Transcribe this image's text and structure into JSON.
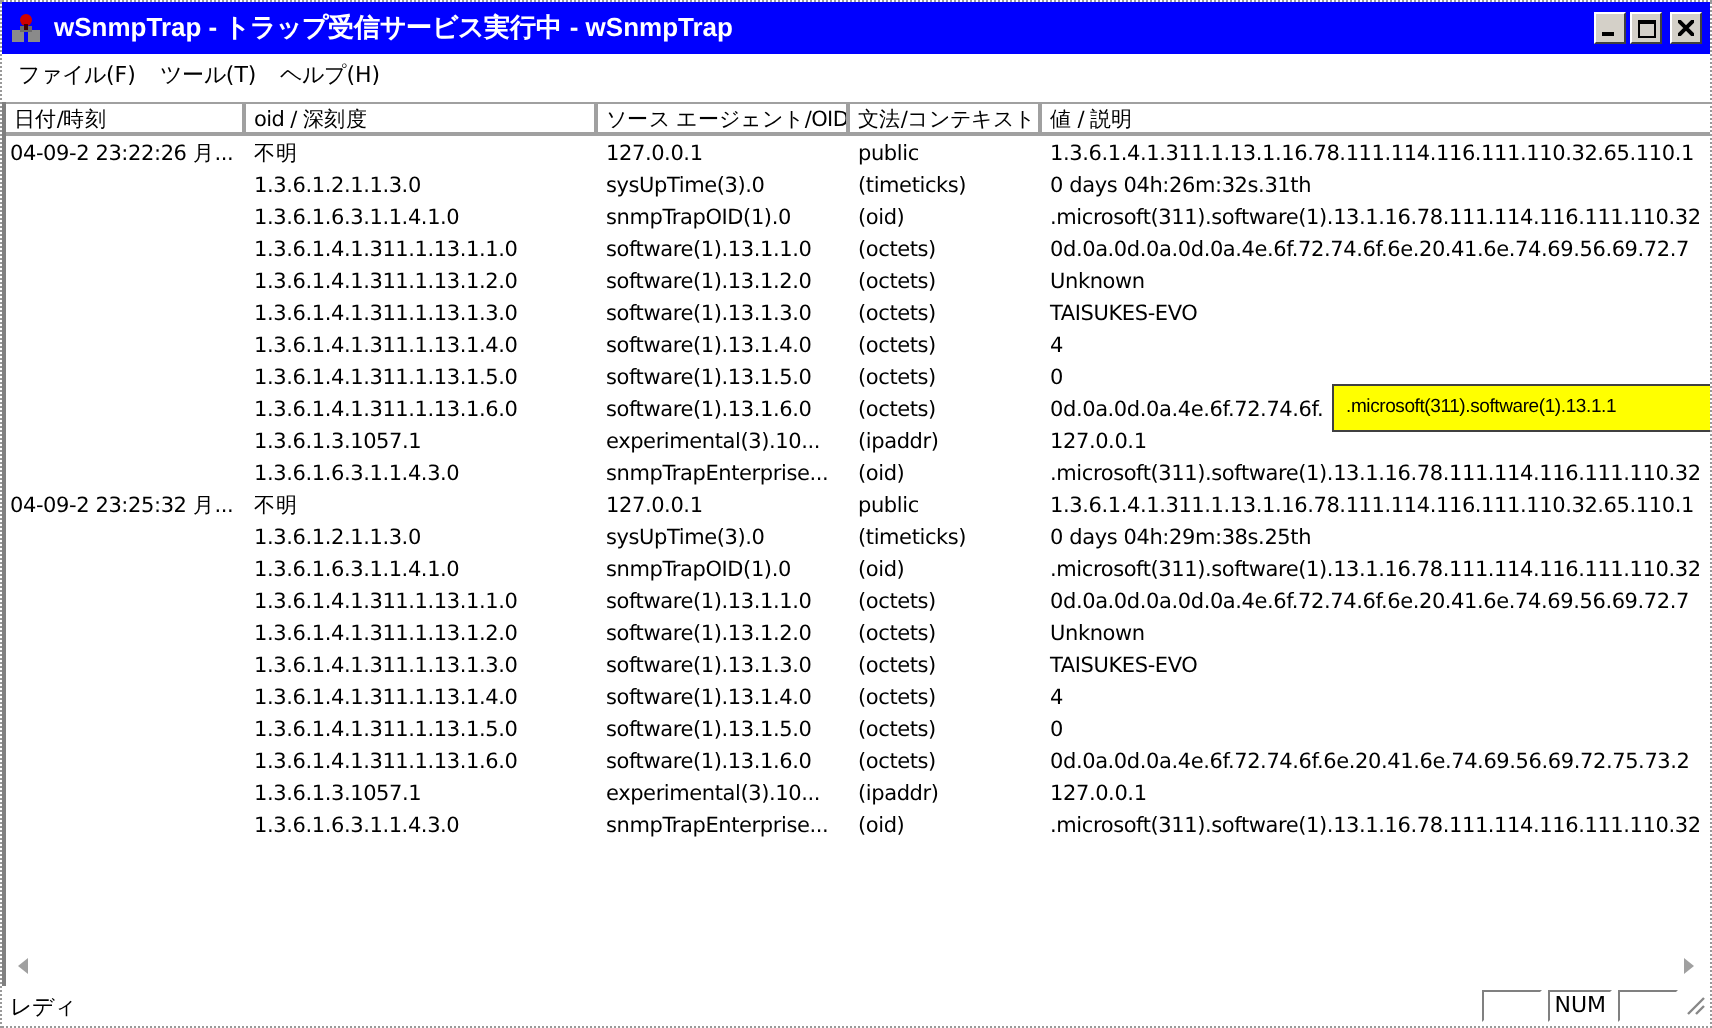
{
  "window": {
    "title": "wSnmpTrap - トラップ受信サービス実行中 - wSnmpTrap"
  },
  "menu": [
    "ファイル(F)",
    "ツール(T)",
    "ヘルプ(H)"
  ],
  "table": {
    "columns": [
      "日付/時刻",
      "oid / 深刻度",
      "ソース エージェント/OID",
      "文法/コンテキスト",
      "値 / 説明"
    ],
    "rows": [
      {
        "date": "04-09-2 23:22:26 月...",
        "oid": "不明",
        "agent": "127.0.0.1",
        "syntax": "public",
        "value": "1.3.6.1.4.1.311.1.13.1.16.78.111.114.116.111.110.32.65.110.1"
      },
      {
        "oid": "1.3.6.1.2.1.1.3.0",
        "agent": "sysUpTime(3).0",
        "syntax": "(timeticks)",
        "value": "0 days 04h:26m:32s.31th"
      },
      {
        "oid": "1.3.6.1.6.3.1.1.4.1.0",
        "agent": "snmpTrapOID(1).0",
        "syntax": "(oid)",
        "value": ".microsoft(311).software(1).13.1.16.78.111.114.116.111.110.32"
      },
      {
        "oid": "1.3.6.1.4.1.311.1.13.1.1.0",
        "agent": "software(1).13.1.1.0",
        "syntax": "(octets)",
        "value": "0d.0a.0d.0a.0d.0a.4e.6f.72.74.6f.6e.20.41.6e.74.69.56.69.72.7"
      },
      {
        "oid": "1.3.6.1.4.1.311.1.13.1.2.0",
        "agent": "software(1).13.1.2.0",
        "syntax": "(octets)",
        "value": "Unknown"
      },
      {
        "oid": "1.3.6.1.4.1.311.1.13.1.3.0",
        "agent": "software(1).13.1.3.0",
        "syntax": "(octets)",
        "value": "TAISUKES-EVO"
      },
      {
        "oid": "1.3.6.1.4.1.311.1.13.1.4.0",
        "agent": "software(1).13.1.4.0",
        "syntax": "(octets)",
        "value": "4"
      },
      {
        "oid": "1.3.6.1.4.1.311.1.13.1.5.0",
        "agent": "software(1).13.1.5.0",
        "syntax": "(octets)",
        "value": "0"
      },
      {
        "oid": "1.3.6.1.4.1.311.1.13.1.6.0",
        "agent": "software(1).13.1.6.0",
        "syntax": "(octets)",
        "value": "0d.0a.0d.0a.4e.6f.72.74.6f.",
        "tooltip": ".microsoft(311).software(1).13.1.1"
      },
      {
        "oid": "1.3.6.1.3.1057.1",
        "agent": "experimental(3).10...",
        "syntax": "(ipaddr)",
        "value": "127.0.0.1"
      },
      {
        "oid": "1.3.6.1.6.3.1.1.4.3.0",
        "agent": "snmpTrapEnterprise...",
        "syntax": "(oid)",
        "value": ".microsoft(311).software(1).13.1.16.78.111.114.116.111.110.32"
      },
      {
        "date": "04-09-2 23:25:32 月...",
        "oid": "不明",
        "agent": "127.0.0.1",
        "syntax": "public",
        "value": "1.3.6.1.4.1.311.1.13.1.16.78.111.114.116.111.110.32.65.110.1"
      },
      {
        "oid": "1.3.6.1.2.1.1.3.0",
        "agent": "sysUpTime(3).0",
        "syntax": "(timeticks)",
        "value": "0 days 04h:29m:38s.25th"
      },
      {
        "oid": "1.3.6.1.6.3.1.1.4.1.0",
        "agent": "snmpTrapOID(1).0",
        "syntax": "(oid)",
        "value": ".microsoft(311).software(1).13.1.16.78.111.114.116.111.110.32"
      },
      {
        "oid": "1.3.6.1.4.1.311.1.13.1.1.0",
        "agent": "software(1).13.1.1.0",
        "syntax": "(octets)",
        "value": "0d.0a.0d.0a.0d.0a.4e.6f.72.74.6f.6e.20.41.6e.74.69.56.69.72.7"
      },
      {
        "oid": "1.3.6.1.4.1.311.1.13.1.2.0",
        "agent": "software(1).13.1.2.0",
        "syntax": "(octets)",
        "value": "Unknown"
      },
      {
        "oid": "1.3.6.1.4.1.311.1.13.1.3.0",
        "agent": "software(1).13.1.3.0",
        "syntax": "(octets)",
        "value": "TAISUKES-EVO"
      },
      {
        "oid": "1.3.6.1.4.1.311.1.13.1.4.0",
        "agent": "software(1).13.1.4.0",
        "syntax": "(octets)",
        "value": "4"
      },
      {
        "oid": "1.3.6.1.4.1.311.1.13.1.5.0",
        "agent": "software(1).13.1.5.0",
        "syntax": "(octets)",
        "value": "0"
      },
      {
        "oid": "1.3.6.1.4.1.311.1.13.1.6.0",
        "agent": "software(1).13.1.6.0",
        "syntax": "(octets)",
        "value": "0d.0a.0d.0a.4e.6f.72.74.6f.6e.20.41.6e.74.69.56.69.72.75.73.2"
      },
      {
        "oid": "1.3.6.1.3.1057.1",
        "agent": "experimental(3).10...",
        "syntax": "(ipaddr)",
        "value": "127.0.0.1"
      },
      {
        "oid": "1.3.6.1.6.3.1.1.4.3.0",
        "agent": "snmpTrapEnterprise...",
        "syntax": "(oid)",
        "value": ".microsoft(311).software(1).13.1.16.78.111.114.116.111.110.32"
      }
    ]
  },
  "status_bar": {
    "text": "レディ",
    "indicator": "NUM"
  }
}
